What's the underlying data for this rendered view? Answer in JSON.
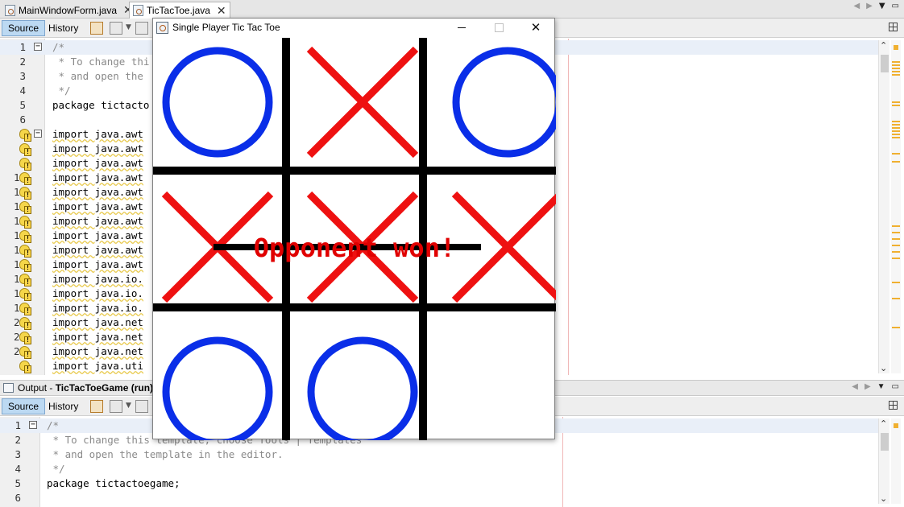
{
  "file_tabs": [
    {
      "label": "MainWindowForm.java",
      "active": false
    },
    {
      "label": "TicTacToe.java",
      "active": true
    }
  ],
  "editor_toolbar": {
    "source_label": "Source",
    "history_label": "History"
  },
  "editor": {
    "line_numbers": [
      "1",
      "2",
      "3",
      "4",
      "5",
      "6",
      "7",
      "8",
      "9",
      "10",
      "11",
      "12",
      "13",
      "14",
      "15",
      "16",
      "17",
      "18",
      "19",
      "20",
      "21",
      "22"
    ],
    "lines": [
      "/*",
      " * To change thi",
      " * and open the",
      " */",
      "package tictacto",
      "",
      "import java.awt",
      "import java.awt",
      "import java.awt",
      "import java.awt",
      "import java.awt",
      "import java.awt",
      "import java.awt",
      "import java.awt",
      "import java.awt",
      "import java.awt",
      "import java.io.",
      "import java.io.",
      "import java.io.",
      "import java.net",
      "import java.net",
      "import java.net",
      "import java.uti"
    ]
  },
  "output_panel": {
    "prefix": "Output - ",
    "title": "TicTacToeGame (run)",
    "source_label": "Source",
    "history_label": "History",
    "line_numbers": [
      "1",
      "2",
      "3",
      "4",
      "5",
      "6"
    ],
    "lines": [
      "/*",
      " * To change this template, choose Tools | Templates",
      " * and open the template in the editor.",
      " */",
      "package tictactoegame;",
      ""
    ]
  },
  "game_window": {
    "title": "Single Player Tic Tac Toe",
    "close_glyph": "✕",
    "board": [
      [
        "O",
        "X",
        "O"
      ],
      [
        "X",
        "X",
        "X"
      ],
      [
        "O",
        "O",
        ""
      ]
    ],
    "winning_row": 2,
    "message": "Opponent won!",
    "colors": {
      "o": "#0a2ee8",
      "x": "#ee1111",
      "grid": "#000000",
      "message": "#e00000"
    }
  }
}
